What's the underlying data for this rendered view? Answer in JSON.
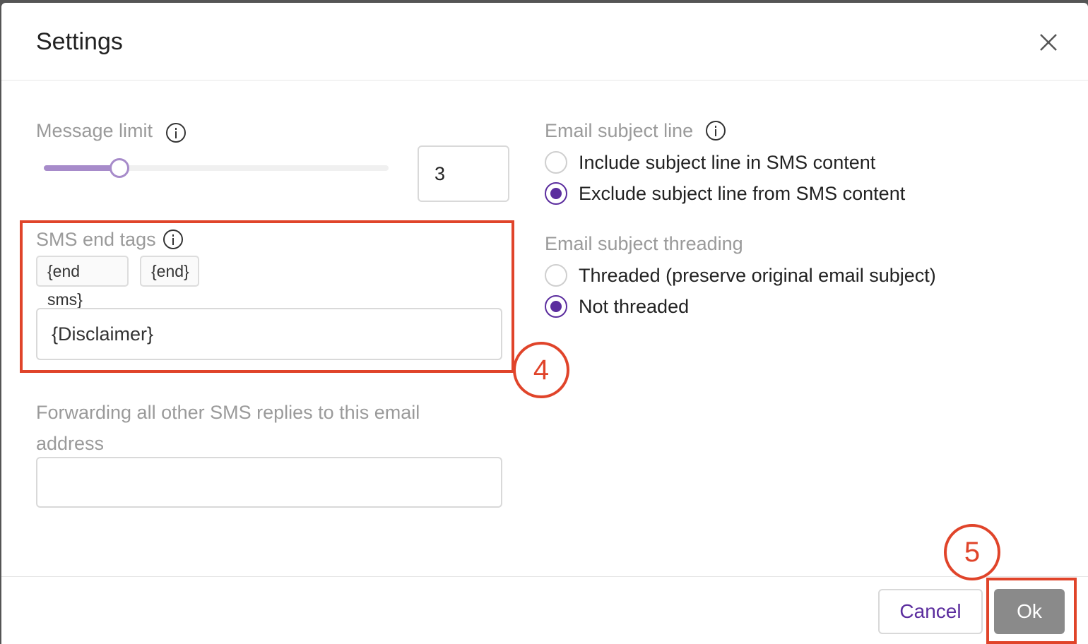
{
  "dialog": {
    "title": "Settings"
  },
  "message_limit": {
    "label": "Message limit",
    "value": "3",
    "slider_fraction": 0.22
  },
  "sms_end_tags": {
    "label": "SMS end tags",
    "tags": [
      "{end sms}",
      "{end}"
    ],
    "input_value": "{Disclaimer}"
  },
  "forwarding": {
    "label": "Forwarding all other SMS replies to this email address",
    "input_value": ""
  },
  "email_subject_line": {
    "label": "Email subject line",
    "options": [
      {
        "label": "Include subject line in SMS content",
        "checked": false
      },
      {
        "label": "Exclude subject line from SMS content",
        "checked": true
      }
    ]
  },
  "email_subject_threading": {
    "label": "Email subject threading",
    "options": [
      {
        "label": "Threaded (preserve original email subject)",
        "checked": false
      },
      {
        "label": "Not threaded",
        "checked": true
      }
    ]
  },
  "footer": {
    "cancel_label": "Cancel",
    "ok_label": "Ok"
  },
  "annotations": {
    "callout_4": "4",
    "callout_5": "5"
  },
  "colors": {
    "accent": "#5b2d9e",
    "slider": "#a78bca",
    "annotation": "#e0442a",
    "ok_button": "#8a8a8a"
  },
  "icons": {
    "close": "close-icon",
    "info": "info-icon"
  }
}
